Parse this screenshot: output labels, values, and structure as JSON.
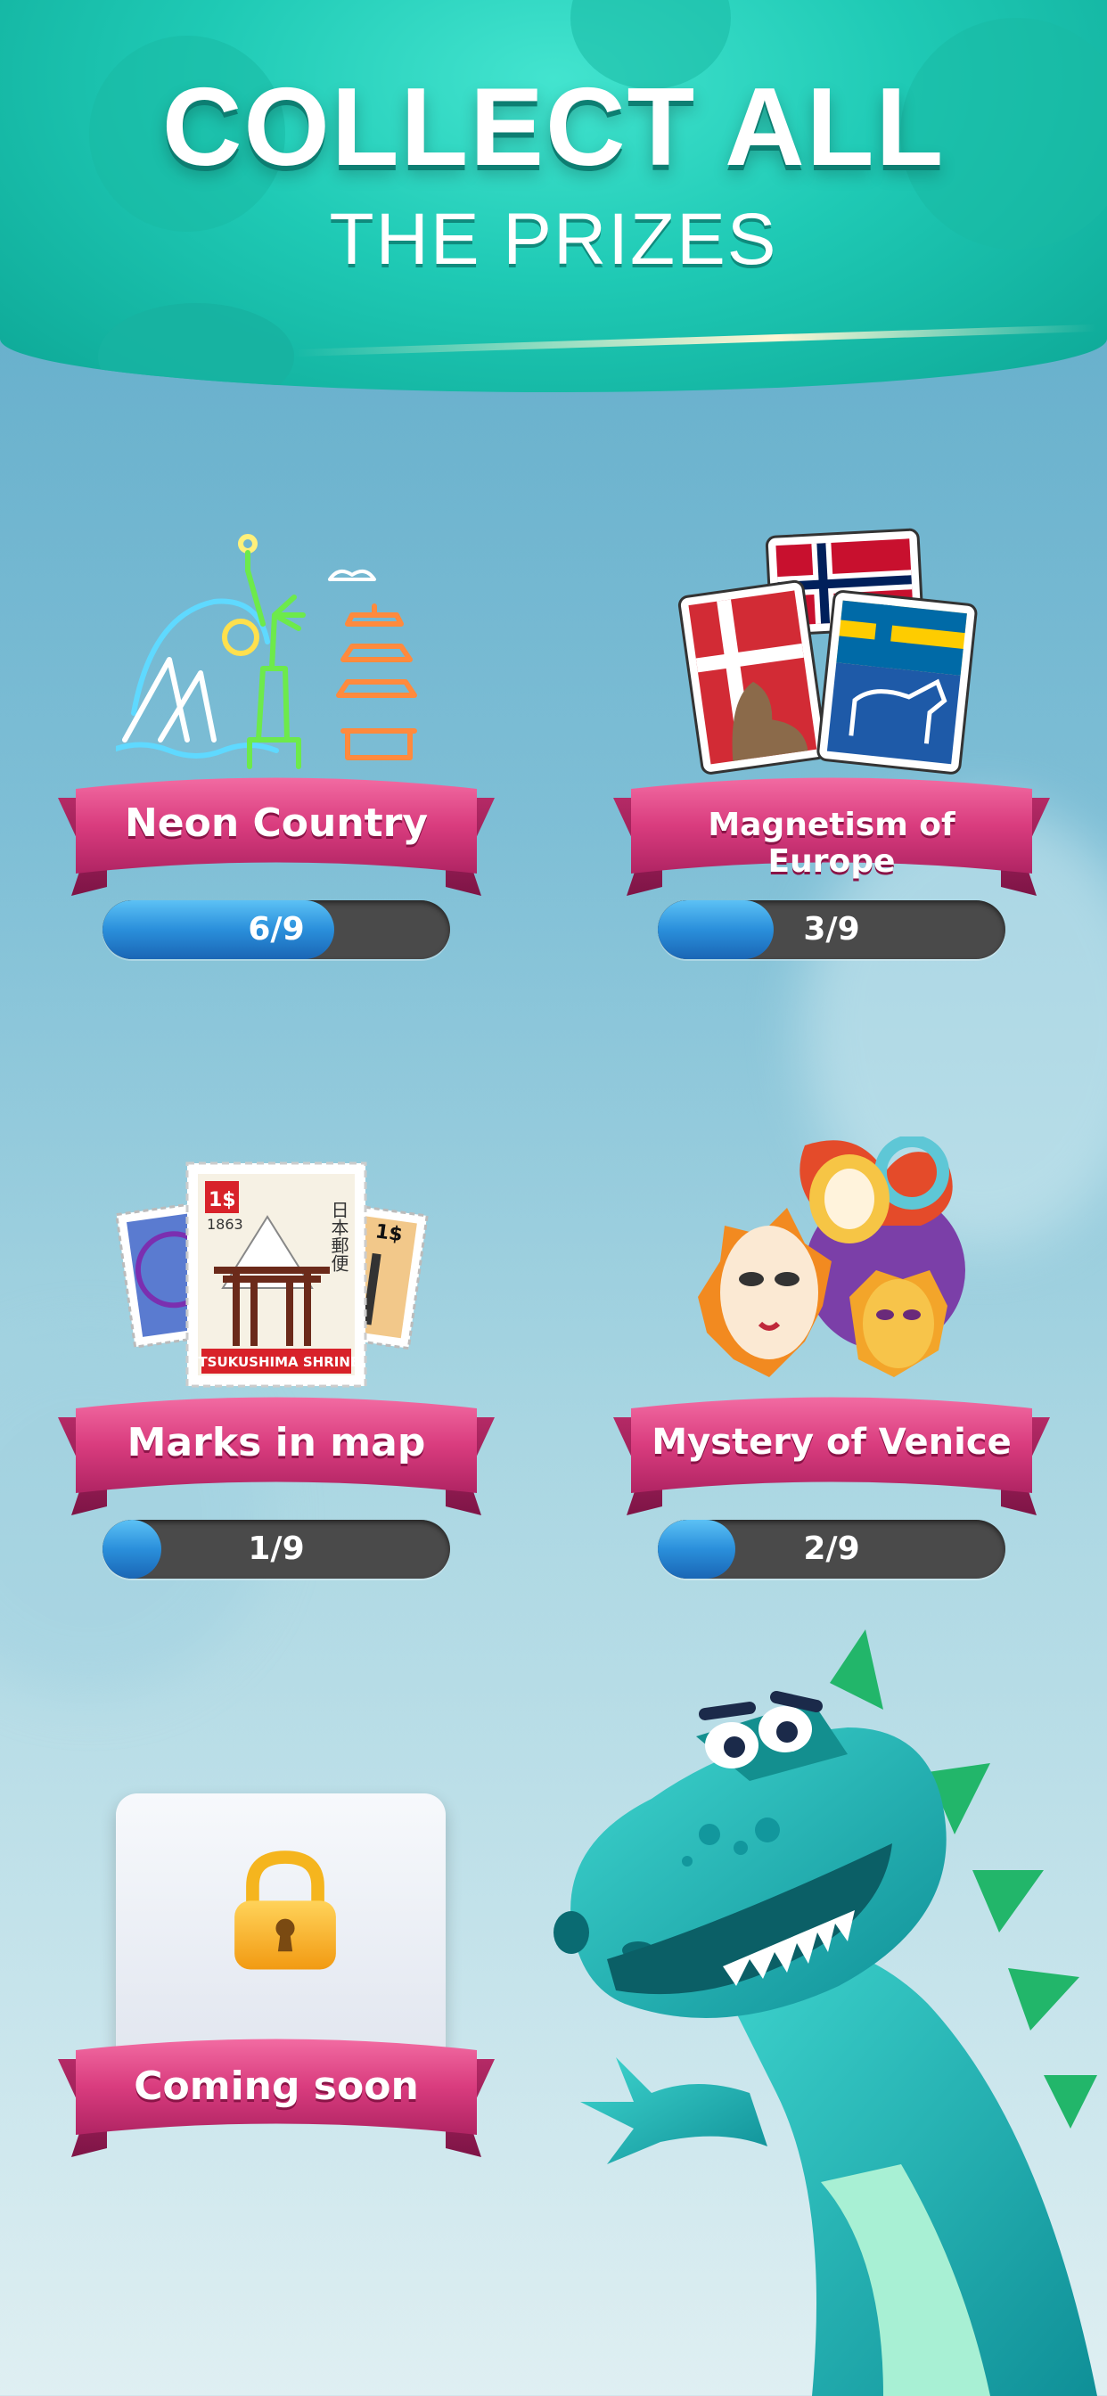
{
  "header": {
    "title_line1": "COLLECT ALL",
    "title_line2": "THE PRIZES"
  },
  "prizes": [
    {
      "label": "Neon Country",
      "progress_text": "6/9",
      "progress": 0.6667
    },
    {
      "label": "Magnetism of Europe",
      "progress_text": "3/9",
      "progress": 0.3333
    },
    {
      "label": "Marks in map",
      "progress_text": "1/9",
      "progress": 0.1111
    },
    {
      "label": "Mystery of Venice",
      "progress_text": "2/9",
      "progress": 0.2222
    }
  ],
  "locked": {
    "label": "Coming soon"
  },
  "art_text": {
    "stamp_price": "1$",
    "stamp_year": "1863",
    "stamp_caption": "ITSUKUSHIMA SHRINE",
    "stamp_kanji": "日本郵便"
  },
  "colors": {
    "header": "#1fcab5",
    "ribbon": "#d93c7e",
    "progress_fill": "#2a8fdb",
    "progress_track": "#4a4a4a",
    "mascot": "#1cb6b3"
  },
  "icons": [
    "statue-of-liberty-neon-icon",
    "europe-magnets-icon",
    "postage-stamps-icon",
    "venice-masks-icon",
    "padlock-icon",
    "dragon-mascot"
  ]
}
